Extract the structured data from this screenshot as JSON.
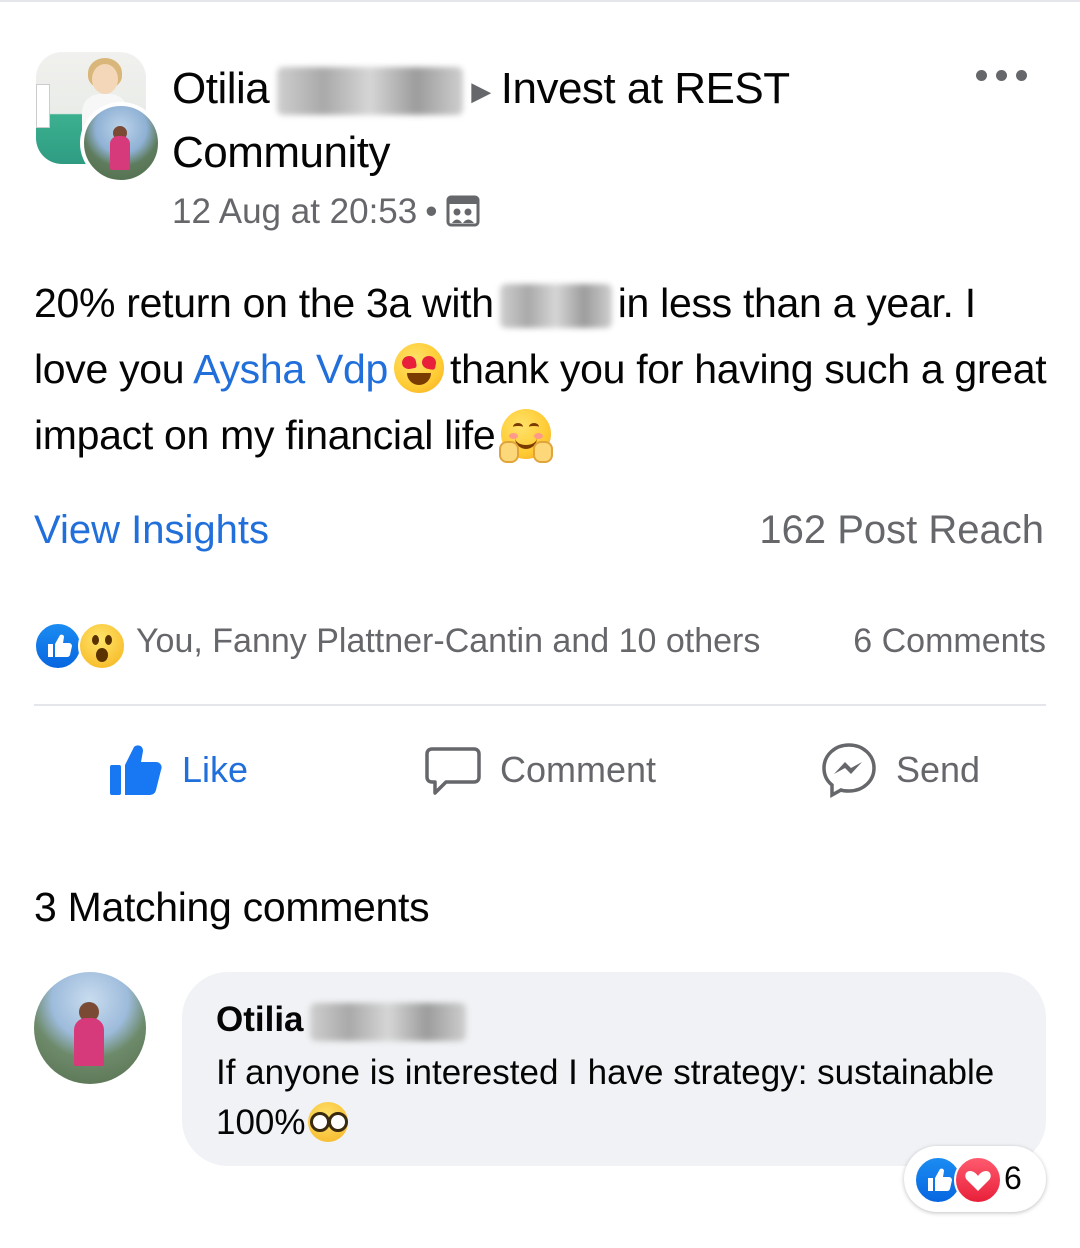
{
  "header": {
    "author_first": "Otilia",
    "group_name_line1": "Invest at REST",
    "group_name_line2": "Community",
    "timestamp": "12 Aug at 20:53",
    "separator": "•"
  },
  "post": {
    "text_part1": "20% return on the 3a with",
    "text_part2": "in less than a year. I love you",
    "mention": "Aysha Vdp",
    "text_part3": "thank you for having such a great impact on my financial life"
  },
  "insights": {
    "view_label": "View Insights",
    "reach": "162 Post Reach"
  },
  "reactions": {
    "summary": "You, Fanny Plattner-Cantin and 10 others",
    "comments": "6 Comments"
  },
  "actions": {
    "like": "Like",
    "comment": "Comment",
    "send": "Send"
  },
  "comments_section": {
    "heading": "3 Matching comments",
    "items": [
      {
        "author_first": "Otilia",
        "text": "If anyone is interested I have strategy: sustainable 100%",
        "reaction_count": "6"
      }
    ]
  },
  "colors": {
    "accent": "#216fdb",
    "muted": "#65676b",
    "bubble": "#f0f2f5",
    "divider": "#e4e6eb"
  },
  "icons": [
    "more-icon",
    "gallery-icon",
    "like-icon",
    "comment-icon",
    "messenger-icon",
    "heart-eyes-emoji",
    "hug-emoji",
    "wow-emoji",
    "glasses-emoji"
  ]
}
